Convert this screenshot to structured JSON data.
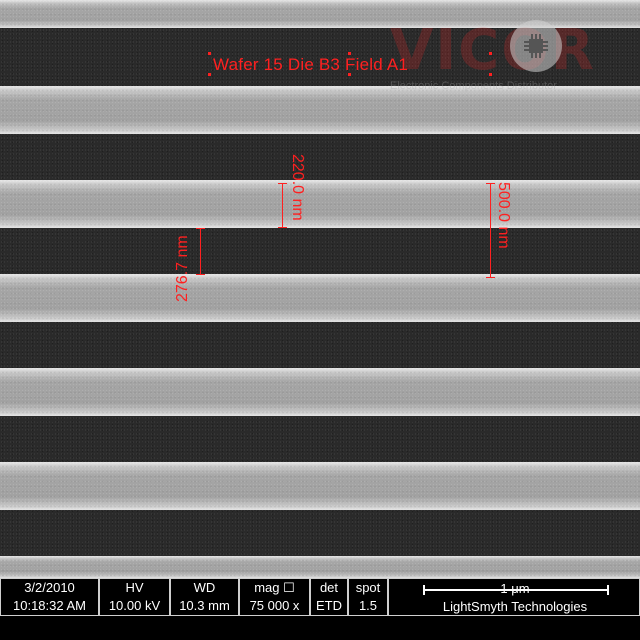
{
  "annotations": {
    "title": "Wafer 15 Die B3 Field A1",
    "measure_1": "276.7 nm",
    "measure_2": "220.0 nm",
    "measure_3": "500.0 nm"
  },
  "watermark": {
    "logo": "VICOR",
    "subtitle": "Electronic Components Distributor",
    "badge_icon": "chip-icon"
  },
  "databar": {
    "date": "3/2/2010",
    "time": "10:18:32 AM",
    "hv_label": "HV",
    "hv_value": "10.00 kV",
    "wd_label": "WD",
    "wd_value": "10.3 mm",
    "mag_label": "mag ☐",
    "mag_value": "75 000 x",
    "det_label": "det",
    "det_value": "ETD",
    "spot_label": "spot",
    "spot_value": "1.5",
    "scale_label": "1 μm",
    "company": "LightSmyth Technologies"
  },
  "colors": {
    "annotation": "#ff2020",
    "background": "#2a2a2a",
    "line": "#a6a6a6"
  }
}
